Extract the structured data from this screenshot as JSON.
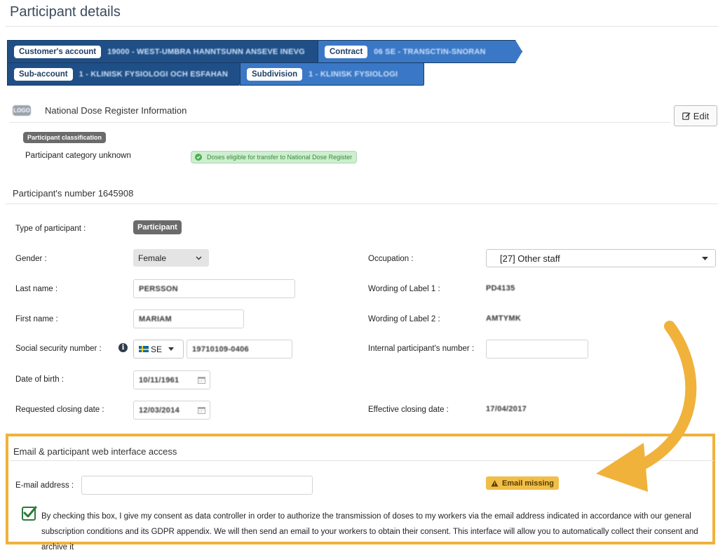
{
  "page": {
    "title": "Participant details"
  },
  "breadcrumbs": [
    {
      "label": "Customer's account",
      "value": "19000 - WEST-UMBRA HANNTSUNN ANSEVE INEVG"
    },
    {
      "label": "Contract",
      "value": "06 SE - TRANSCTIN-SNORAN"
    },
    {
      "label": "Sub-account",
      "value": "1 - KLINISK FYSIOLOGI OCH ESFAHAN"
    },
    {
      "label": "Subdivision",
      "value": "1 - KLINISK FYSIOLOGI"
    }
  ],
  "ndr": {
    "icon_text": "LOGO",
    "title": "National Dose Register Information",
    "edit_label": "Edit",
    "classification_badge": "Participant classification",
    "category_text": "Participant category unknown",
    "eligible_text": "Doses eligible for transfer to National Dose Register"
  },
  "participant": {
    "section_title": "Participant's number 1645908",
    "type_label": "Type of participant :",
    "type_value": "Participant",
    "gender_label": "Gender :",
    "gender_value": "Female",
    "occupation_label": "Occupation :",
    "occupation_value": "[27] Other staff",
    "last_name_label": "Last name :",
    "last_name_value": "PERSSON",
    "label1_label": "Wording of Label 1 :",
    "label1_value": "PD4135",
    "first_name_label": "First name :",
    "first_name_value": "MARIAM",
    "label2_label": "Wording of Label 2 :",
    "label2_value": "AMTYMK",
    "ssn_label": "Social security number :",
    "ssn_country": "SE",
    "ssn_value": "19710109-0406",
    "internal_label": "Internal participant's number :",
    "internal_value": "",
    "dob_label": "Date of birth :",
    "dob_value": "10/11/1961",
    "req_close_label": "Requested closing date :",
    "req_close_value": "12/03/2014",
    "eff_close_label": "Effective closing date :",
    "eff_close_value": "17/04/2017"
  },
  "email_section": {
    "title": "Email & participant web interface access",
    "email_label": "E-mail address :",
    "email_value": "",
    "missing_badge": "Email missing",
    "consent_checked": true,
    "consent_text": "By checking this box, I give my consent as data controller in order to authorize the transmission of doses to my workers via the email address indicated in accordance with our general subscription conditions and its GDPR appendix. We will then send an email to your workers to obtain their consent. This interface will allow you to automatically collect their consent and archive it"
  },
  "colors": {
    "breadcrumb_dark": "#1f4f86",
    "breadcrumb_light": "#3a78c6",
    "highlight": "#f0b23b",
    "success": "#4caf50"
  }
}
